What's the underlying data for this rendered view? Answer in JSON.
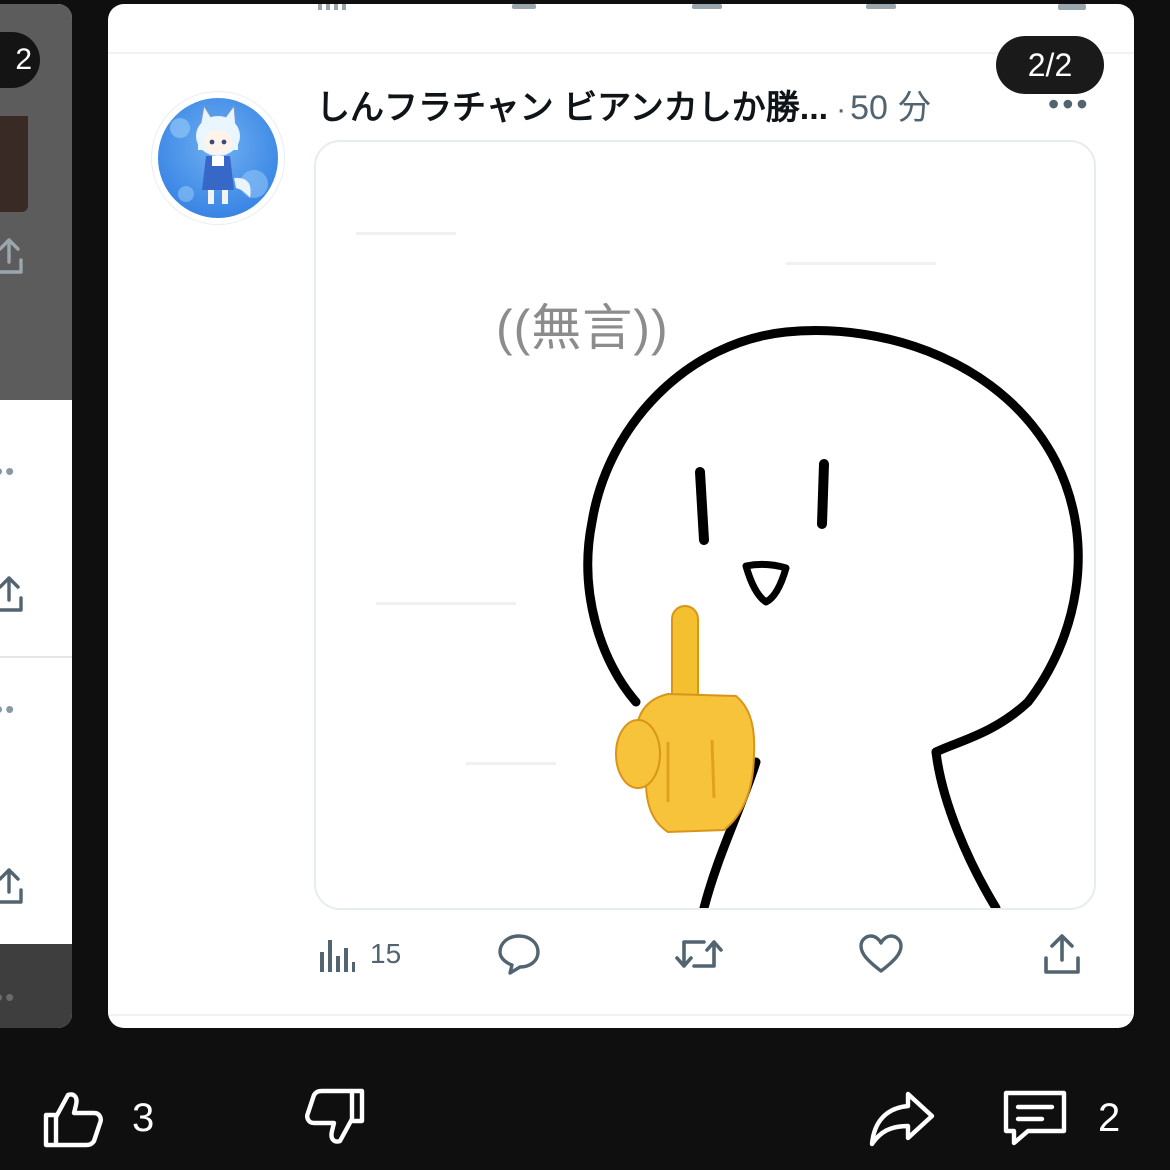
{
  "prev_slide": {
    "counter": "2"
  },
  "post": {
    "slide_counter": "2/2",
    "author_name": "しんフラチャン ビアンカしか勝...",
    "separator": "·",
    "time": "50 分",
    "more": "•••",
    "media_caption": "((無言))",
    "metrics": {
      "views": "15"
    },
    "icons": [
      "views-icon",
      "reply-icon",
      "retweet-icon",
      "like-icon",
      "share-icon"
    ]
  },
  "reactions": {
    "likes": "3",
    "comments": "2",
    "icons": [
      "thumbs-up-icon",
      "thumbs-down-icon",
      "share-arrow-icon",
      "comment-icon"
    ]
  },
  "colors": {
    "background": "#0f0f0f",
    "card": "#ffffff",
    "muted_icon": "#536471",
    "text": "#0f1419"
  }
}
